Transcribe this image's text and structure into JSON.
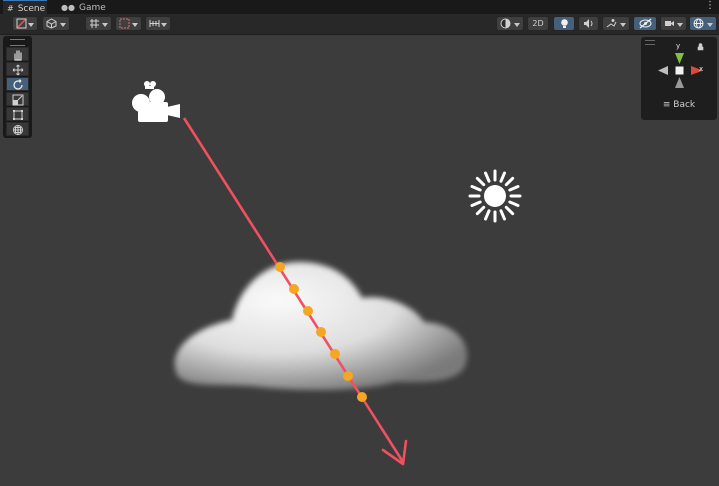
{
  "tabs": [
    {
      "label": "Scene",
      "icon": "grid-icon",
      "active": true
    },
    {
      "label": "Game",
      "icon": "gamepad-icon",
      "active": false
    }
  ],
  "toolbar": {
    "twod_label": "2D"
  },
  "gizmo": {
    "x_label": "x",
    "y_label": "y",
    "back_label": "Back",
    "colors": {
      "x": "#e0483a",
      "y": "#7fc241",
      "z": "#9a9a9a"
    }
  },
  "tools": [
    {
      "name": "hand",
      "selected": false
    },
    {
      "name": "move",
      "selected": false
    },
    {
      "name": "rotate",
      "selected": true
    },
    {
      "name": "scale",
      "selected": false
    },
    {
      "name": "rect",
      "selected": false
    },
    {
      "name": "transform",
      "selected": false
    }
  ],
  "scene": {
    "ray_color": "#f05060",
    "hit_marker_color": "#f5a623",
    "hit_marker_count": 7
  }
}
